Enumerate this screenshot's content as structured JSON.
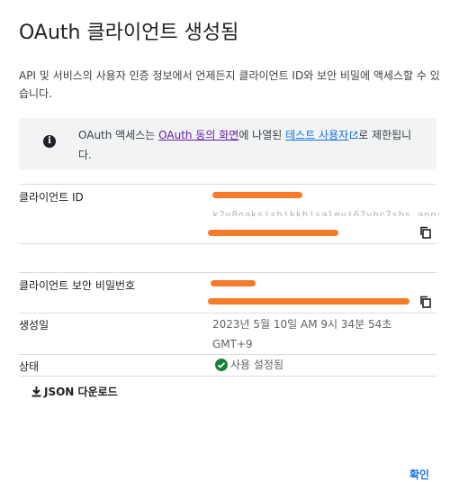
{
  "dialog": {
    "title": "OAuth 클라이언트 생성됨",
    "description": "API 및 서비스의 사용자 인증 정보에서 언제든지 클라이언트 ID와 보안 비밀에 액세스할 수 있습니다.",
    "info": {
      "icon": "info-icon",
      "text_prefix": "OAuth 액세스는 ",
      "link1": "OAuth 동의 화면",
      "text_mid": "에 나열된 ",
      "link2": "테스트 사용자",
      "text_suffix": "로 제한됩니다."
    },
    "fields": {
      "client_id": {
        "label": "클라이언트 ID"
      },
      "client_secret": {
        "label": "클라이언트 보안 비밀번호"
      },
      "created": {
        "label": "생성일",
        "value": "2023년 5월 10일 AM 9시 34분 54초 GMT+9"
      },
      "status": {
        "label": "상태",
        "value": "사용 설정됨"
      }
    },
    "download_label": "JSON 다운로드",
    "confirm_label": "확인"
  },
  "colors": {
    "accent": "#1a73e8",
    "visited_link": "#681da8",
    "success": "#188038",
    "redaction": "#f57a2a"
  }
}
